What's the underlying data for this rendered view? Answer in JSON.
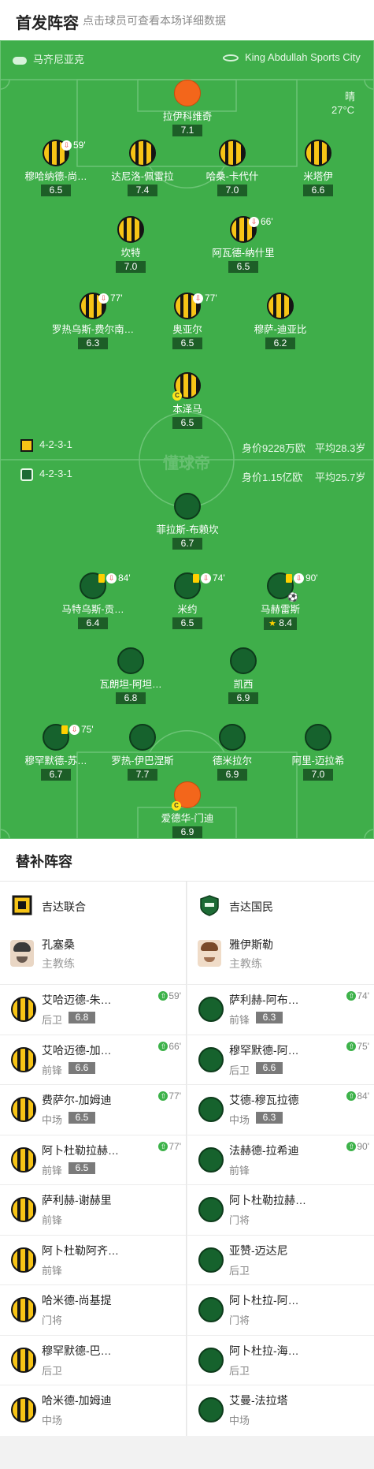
{
  "header": {
    "title": "首发阵容",
    "subtitle": "点击球员可查看本场详细数据"
  },
  "match": {
    "referee": "马齐尼亚克",
    "stadium": "King Abdullah Sports City",
    "weather": "晴",
    "temp": "27°C",
    "watermark": "懂球帝"
  },
  "home": {
    "formation": "4-2-3-1",
    "value": "身价9228万欧",
    "age": "平均28.3岁"
  },
  "away": {
    "formation": "4-2-3-1",
    "value": "身价1.15亿欧",
    "age": "平均25.7岁"
  },
  "home_lineup": [
    {
      "name": "拉伊科维奇",
      "rating": "7.1",
      "gk": true
    },
    {
      "name": "穆哈纳德-尚…",
      "rating": "6.5",
      "sub": "59'"
    },
    {
      "name": "达尼洛-佩雷拉",
      "rating": "7.4"
    },
    {
      "name": "哈桑-卡代什",
      "rating": "7.0"
    },
    {
      "name": "米塔伊",
      "rating": "6.6"
    },
    {
      "name": "坎特",
      "rating": "7.0"
    },
    {
      "name": "阿瓦德-纳什里",
      "rating": "6.5",
      "sub": "66'"
    },
    {
      "name": "罗热乌斯-费尔南…",
      "rating": "6.3",
      "sub": "77'"
    },
    {
      "name": "奥亚尔",
      "rating": "6.5",
      "sub": "77'"
    },
    {
      "name": "穆萨-迪亚比",
      "rating": "6.2"
    },
    {
      "name": "本泽马",
      "rating": "6.5",
      "captain": "C"
    }
  ],
  "away_lineup": [
    {
      "name": "菲拉斯-布赖坎",
      "rating": "6.7"
    },
    {
      "name": "马特乌斯-贡…",
      "rating": "6.4",
      "sub": "84'"
    },
    {
      "name": "米约",
      "rating": "6.5",
      "sub": "74'"
    },
    {
      "name": "马赫雷斯",
      "rating": "8.4",
      "sub": "90'"
    },
    {
      "name": "瓦朗坦-阿坦…",
      "rating": "6.8"
    },
    {
      "name": "凯西",
      "rating": "6.9"
    },
    {
      "name": "穆罕默德-苏…",
      "rating": "6.7",
      "sub": "75'"
    },
    {
      "name": "罗热-伊巴涅斯",
      "rating": "7.7"
    },
    {
      "name": "德米拉尔",
      "rating": "6.9"
    },
    {
      "name": "阿里-迈拉希",
      "rating": "7.0"
    },
    {
      "name": "爱德华-门迪",
      "rating": "6.9",
      "gk": true,
      "captain": "C"
    }
  ],
  "subs": {
    "title": "替补阵容",
    "home_team": "吉达联合",
    "away_team": "吉达国民",
    "home_coach": {
      "name": "孔塞桑",
      "role": "主教练"
    },
    "away_coach": {
      "name": "雅伊斯勒",
      "role": "主教练"
    },
    "home": [
      {
        "name": "艾哈迈德-朱…",
        "pos": "后卫",
        "rating": "6.8",
        "time": "59'"
      },
      {
        "name": "艾哈迈德-加…",
        "pos": "前锋",
        "rating": "6.6",
        "time": "66'"
      },
      {
        "name": "费萨尔-加姆迪",
        "pos": "中场",
        "rating": "6.5",
        "time": "77'"
      },
      {
        "name": "阿卜杜勒拉赫…",
        "pos": "前锋",
        "rating": "6.5",
        "time": "77'"
      },
      {
        "name": "萨利赫-谢赫里",
        "pos": "前锋"
      },
      {
        "name": "阿卜杜勒阿齐…",
        "pos": "前锋"
      },
      {
        "name": "哈米德-尚基提",
        "pos": "门将"
      },
      {
        "name": "穆罕默德-巴…",
        "pos": "后卫"
      },
      {
        "name": "哈米德-加姆迪",
        "pos": "中场"
      }
    ],
    "away": [
      {
        "name": "萨利赫-阿布…",
        "pos": "前锋",
        "rating": "6.3",
        "time": "74'"
      },
      {
        "name": "穆罕默德-阿…",
        "pos": "后卫",
        "rating": "6.6",
        "time": "75'"
      },
      {
        "name": "艾德-穆瓦拉德",
        "pos": "中场",
        "rating": "6.3",
        "time": "84'"
      },
      {
        "name": "法赫德-拉希迪",
        "pos": "前锋",
        "time": "90'"
      },
      {
        "name": "阿卜杜勒拉赫…",
        "pos": "门将"
      },
      {
        "name": "亚赞-迈达尼",
        "pos": "后卫"
      },
      {
        "name": "阿卜杜拉-阿…",
        "pos": "门将"
      },
      {
        "name": "阿卜杜拉-海…",
        "pos": "后卫"
      },
      {
        "name": "艾曼-法拉塔",
        "pos": "中场"
      }
    ]
  },
  "colors": {
    "pitch": "#3fae4a",
    "home_shirt": "#f7c416",
    "away_shirt": "#16622d",
    "gk_shirt": "#f3661b",
    "sub_in": "#3db24a"
  },
  "icons": [
    "whistle-icon",
    "stadium-icon",
    "home-badge-icon",
    "away-badge-icon",
    "captain-icon",
    "yellow-card-icon",
    "substitution-icon",
    "goal-icon",
    "star-icon",
    "sub-in-icon"
  ]
}
